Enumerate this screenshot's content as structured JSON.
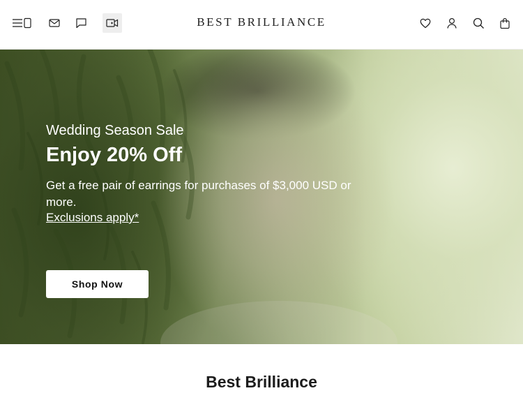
{
  "header": {
    "brand": "BEST BRILLIANCE",
    "left_icons": [
      "menu-icon",
      "mail-icon",
      "chat-icon",
      "video-call-icon"
    ],
    "right_icons": [
      "heart-icon",
      "account-icon",
      "search-icon",
      "cart-icon"
    ]
  },
  "hero": {
    "eyebrow": "Wedding Season Sale",
    "headline": "Enjoy 20% Off",
    "body": "Get a free pair of earrings for purchases of $3,000 USD or more.",
    "link": "Exclusions apply*",
    "button": "Shop Now"
  },
  "section": {
    "title": "Best Brilliance"
  },
  "colors": {
    "accent": "#ffffff",
    "text": "#1a1a1a",
    "hero_tint": "#8da06e"
  }
}
